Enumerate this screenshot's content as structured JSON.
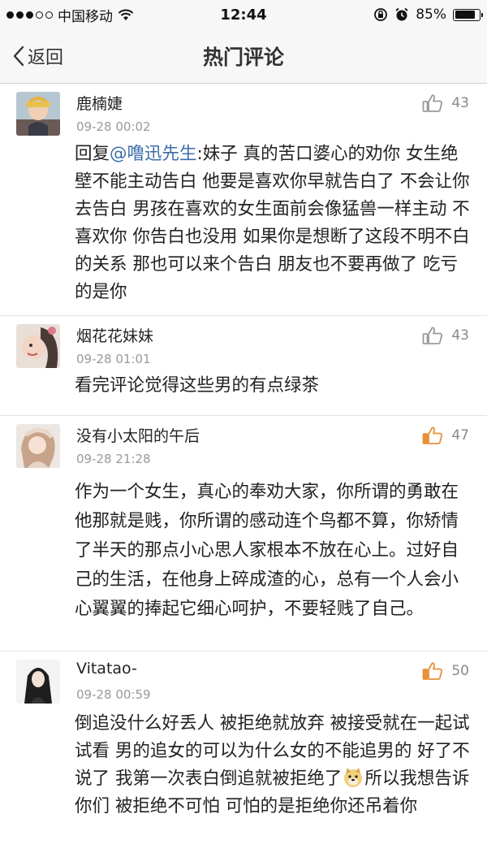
{
  "status_bar": {
    "carrier": "中国移动",
    "time": "12:44",
    "battery": "85%",
    "battery_level": 0.85
  },
  "nav": {
    "back_label": "返回",
    "title": "热门评论"
  },
  "comments": [
    {
      "author": "鹿楠婕",
      "time": "09-28 00:02",
      "likes": "43",
      "liked": false,
      "reply_prefix": "回复",
      "mention": "@噜迅先生",
      "body": ":妹子 真的苦口婆心的劝你 女生绝壁不能主动告白 他要是喜欢你早就告白了 不会让你去告白 男孩在喜欢的女生面前会像猛兽一样主动 不喜欢你 你告白也没用 如果你是想断了这段不明不白的关系 那也可以来个告白 朋友也不要再做了 吃亏的是你"
    },
    {
      "author": "烟花花妹妹",
      "time": "09-28 01:01",
      "likes": "43",
      "liked": false,
      "body": "看完评论觉得这些男的有点绿茶"
    },
    {
      "author": "没有小太阳的午后",
      "time": "09-28 21:28",
      "likes": "47",
      "liked": true,
      "body": "作为一个女生，真心的奉劝大家，你所谓的勇敢在他那就是贱，你所谓的感动连个鸟都不算，你矫情了半天的那点小心思人家根本不放在心上。过好自己的生活，在他身上碎成渣的心，总有一个人会小心翼翼的捧起它细心呵护，不要轻贱了自己。"
    },
    {
      "author": "Vitatao-",
      "time": "09-28 00:59",
      "likes": "50",
      "liked": true,
      "body_part1": "倒追没什么好丢人 被拒绝就放弃 被接受就在一起试试看 男的追女的可以为什么女的不能追男的 好了不说了 我第一次表白倒追就被拒绝了",
      "emoji": "doge-emoji",
      "body_part2": "所以我想告诉你们 被拒绝不可怕 可怕的是拒绝你还吊着你"
    }
  ],
  "colors": {
    "liked": "#e8903a",
    "unliked": "#9a9a9a",
    "mention": "#3d6ea8"
  }
}
